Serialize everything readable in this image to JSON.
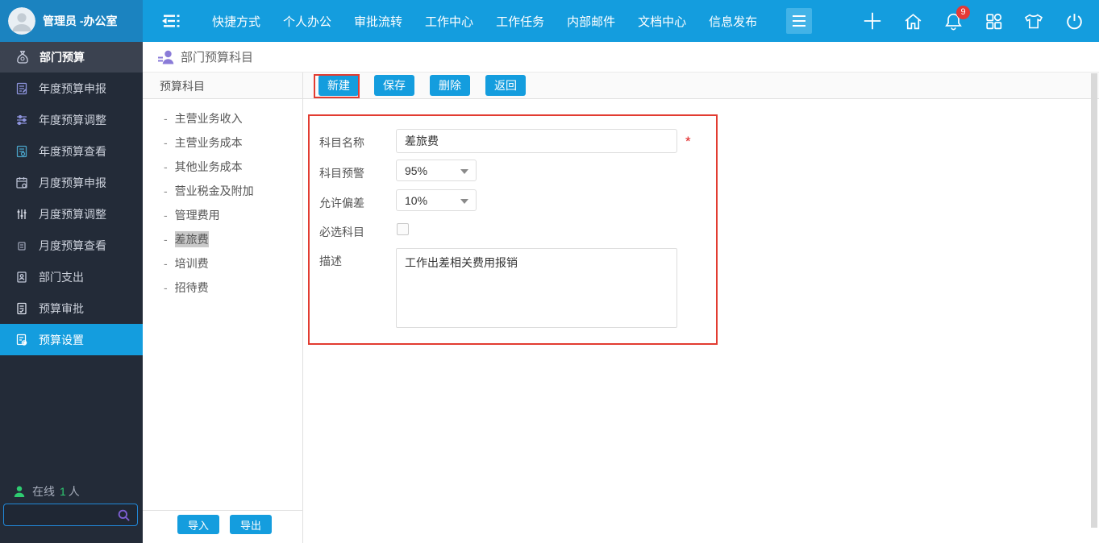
{
  "topbar": {
    "user": "管理员 -办公室",
    "nav": [
      "快捷方式",
      "个人办公",
      "审批流转",
      "工作中心",
      "工作任务",
      "内部邮件",
      "文档中心",
      "信息发布"
    ],
    "notification_count": "9",
    "right_icons": [
      "plus-icon",
      "home-icon",
      "bell-icon",
      "apps-icon",
      "theme-icon",
      "power-icon"
    ]
  },
  "sidebar": {
    "header": "部门预算",
    "items": [
      {
        "label": "年度预算申报"
      },
      {
        "label": "年度预算调整"
      },
      {
        "label": "年度预算查看"
      },
      {
        "label": "月度预算申报"
      },
      {
        "label": "月度预算调整"
      },
      {
        "label": "月度预算查看"
      },
      {
        "label": "部门支出"
      },
      {
        "label": "预算审批"
      },
      {
        "label": "预算设置",
        "selected": true
      }
    ],
    "online_label": "在线",
    "online_count": "1",
    "online_unit": "人"
  },
  "page": {
    "title": "部门预算科目"
  },
  "panel": {
    "title": "预算科目",
    "tree": [
      "主营业务收入",
      "主营业务成本",
      "其他业务成本",
      "营业税金及附加",
      "管理费用",
      "差旅费",
      "培训费",
      "招待费"
    ],
    "selected_item": "差旅费",
    "import_label": "导入",
    "export_label": "导出"
  },
  "toolbar": {
    "new": "新建",
    "save": "保存",
    "delete": "删除",
    "back": "返回"
  },
  "form": {
    "name": {
      "label": "科目名称",
      "value": "差旅费",
      "required_mark": "*"
    },
    "warning": {
      "label": "科目预警",
      "value": "95%"
    },
    "deviation": {
      "label": "允许偏差",
      "value": "10%"
    },
    "required_subject": {
      "label": "必选科目",
      "checked": false
    },
    "description": {
      "label": "描述",
      "value": "工作出差相关费用报销"
    }
  },
  "colors": {
    "topbar_blue": "#149dde",
    "topbar_left_blue": "#1b83c0",
    "sidebar_bg": "#232b38",
    "sidebar_header_bg": "#3b4250",
    "selected_blue": "#149dde",
    "button_blue": "#149dde",
    "annotation_red": "#e23c31",
    "badge_red": "#e53935",
    "online_green": "#2ecc71",
    "search_border_blue": "#2188d8",
    "tree_selected_gray": "#c9c9c9"
  }
}
